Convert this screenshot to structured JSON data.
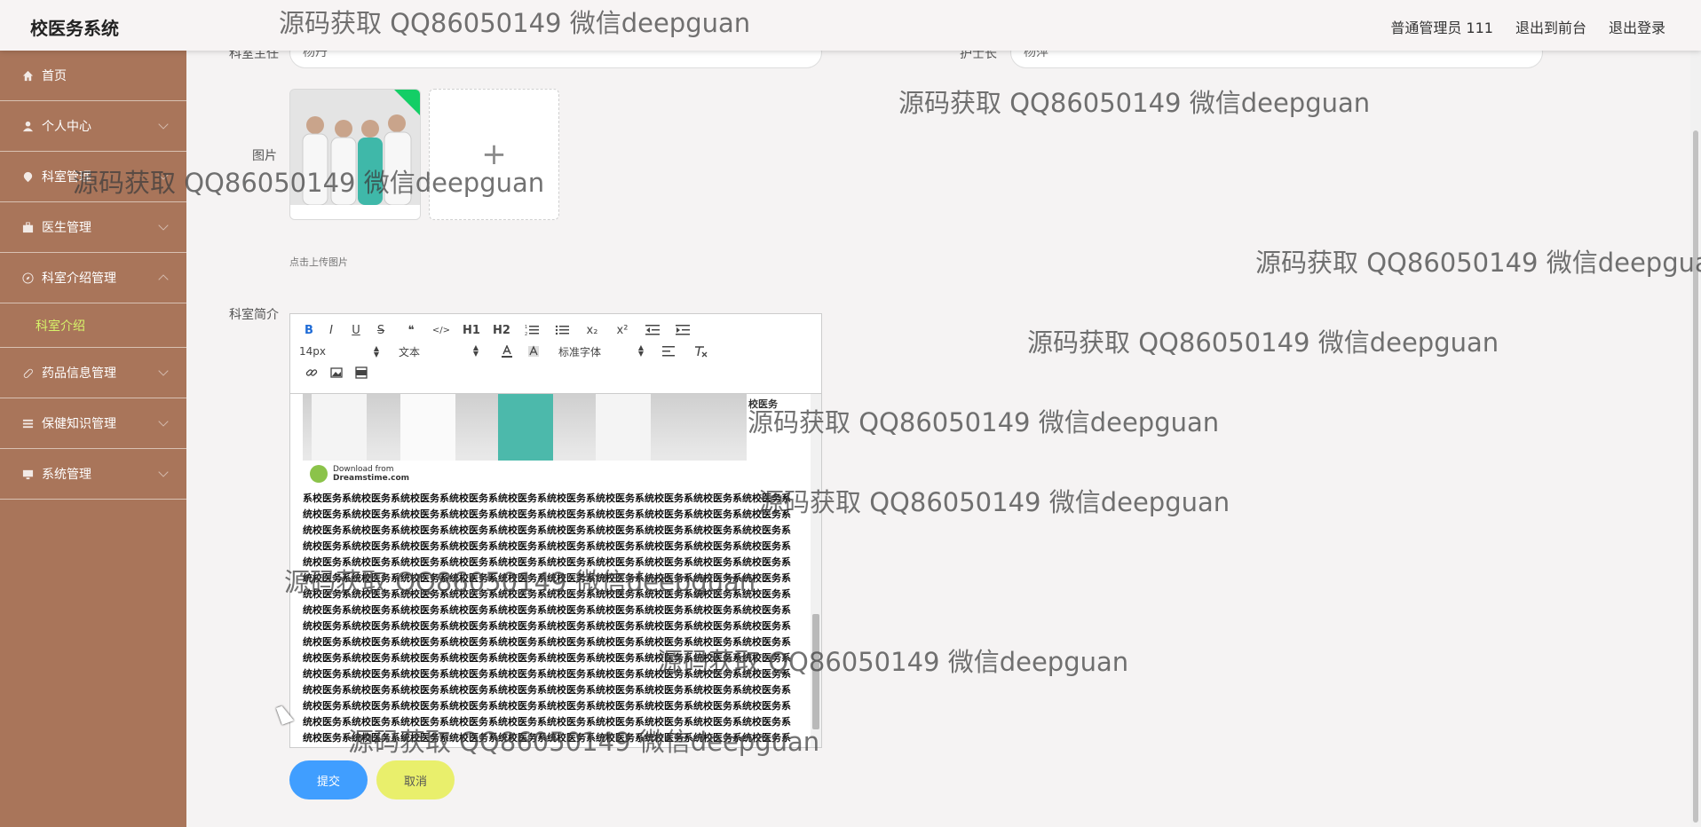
{
  "header": {
    "app_title": "校医务系统",
    "user_label": "普通管理员 111",
    "front_link": "退出到前台",
    "logout_link": "退出登录"
  },
  "sidebar": {
    "items": [
      {
        "label": "首页",
        "icon": "home-icon"
      },
      {
        "label": "个人中心",
        "icon": "user-icon"
      },
      {
        "label": "科室管理",
        "icon": "location-icon"
      },
      {
        "label": "医生管理",
        "icon": "briefcase-icon"
      },
      {
        "label": "科室介绍管理",
        "icon": "compass-icon"
      },
      {
        "label": "药品信息管理",
        "icon": "pill-icon"
      },
      {
        "label": "保健知识管理",
        "icon": "menu-icon"
      },
      {
        "label": "系统管理",
        "icon": "system-icon"
      }
    ],
    "active_sub_item": "科室介绍",
    "accent_color": "#d6f26a",
    "bg_color": "#a9755a"
  },
  "form": {
    "director_label": "科室主任",
    "director_value": "杨丹",
    "nurse_label": "护士长",
    "nurse_value": "杨萍",
    "image_label": "图片",
    "upload_tip": "点击上传图片",
    "intro_label": "科室简介"
  },
  "editor": {
    "toolbar": {
      "row1": [
        "B",
        "I",
        "U",
        "S",
        "❝",
        "</>",
        "H1",
        "H2",
        "ol",
        "ul",
        "x₂",
        "x²",
        "outdent",
        "indent"
      ],
      "font_size": "14px",
      "block_type": "文本",
      "font_family": "标准字体"
    },
    "image_caption_line1": "Download from",
    "image_caption_line2": "Dreamstime.com",
    "lead_text": "校医务",
    "body_text": "系校医务系统校医务系统校医务系统校医务系统校医务系统校医务系统校医务系统校医务系统校医务系统校医务系统校医务系统校医务系统校医务系统校医务系统校医务系统校医务系统校医务系统校医务系统校医务系统校医务系统校医务系统校医务系统校医务系统校医务系统校医务系统校医务系统校医务系统校医务系统校医务系统校医务系统校医务系统校医务系统校医务系统校医务系统校医务系统校医务系统校医务系统校医务系统校医务系统校医务系统校医务系统校医务系统校医务系统校医务系统校医务系统校医务系统校医务系统校医务系统校医务系统校医务系统校医务系统校医务系统校医务系统校医务系统校医务系统校医务系统校医务系统校医务系统校医务系统校医务系统校医务系统校医务系统校医务系统校医务系统校医务系统校医务系统校医务系统校医务系统校医务系统校医务系统校医务系统校医务系统校医务系统校医务系统校医务系统校医务系统校医务系统校医务系统校医务系统校医务系统校医务系统校医务系统校医务系统校医务系统校医务系统校医务系统校医务系统校医务系统校医务系统校医务系统校医务系统校医务系统校医务系统校医务系统校医务系统校医务系统校医务系统校医务系统校医务系统校医务系统校医务系统校医务系统校医务系统校医务系统校医务系统校医务系统校医务系统校医务系统校医务系统校医务系统校医务系统校医务系统校医务系统校医务系统校医务系统校医务系统校医务系统校医务系统校医务系统校医务系统校医务系统校医务系统校医务系统校医务系统校医务系统校医务系统校医务系统校医务系统校医务系统校医务系统校医务系统校医务系统校医务系统校医务系统校医务系统校医务系统校医务系统校医务系统校医务系统校医务系统校医务系统校医务系统校医务系统校医务系统校医务系统校医务系统校医务系统校医务系统校医务系统校医务系统校医务系统校医务系统校医务系统校医务系统校医务系统校医务系统校医务系统校医务系统校医务系统校医务系统校医务系统校医务系统校医务系统校医务系统校医务系统校医务系统校医务系统校医务系统校医务系统校医务系统校医务系统校医务系统校医务系统校医务系统校医务系统"
  },
  "buttons": {
    "submit": "提交",
    "cancel": "取消",
    "submit_color": "#409eff",
    "cancel_color": "#e9ef6c"
  },
  "watermark_text": "源码获取 QQ86050149 微信deepguan"
}
